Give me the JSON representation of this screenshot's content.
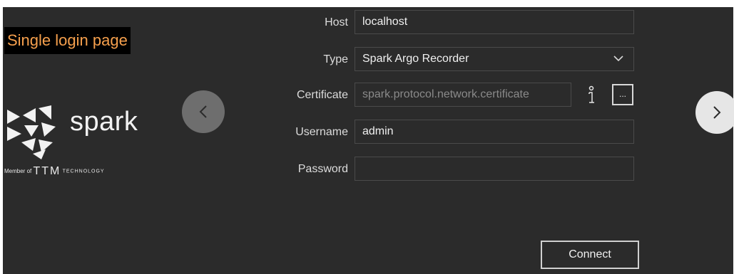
{
  "annotation": {
    "text": "Single login page"
  },
  "logo": {
    "word": "spark",
    "member_prefix": "Member of",
    "parent_brand": "TTM",
    "parent_suffix": "TECHNOLOGY"
  },
  "navigation": {
    "prev_icon": "chevron-left-icon",
    "next_icon": "chevron-right-icon"
  },
  "form": {
    "host": {
      "label": "Host",
      "value": "localhost"
    },
    "type": {
      "label": "Type",
      "value": "Spark Argo Recorder"
    },
    "certificate": {
      "label": "Certificate",
      "value": "spark.protocol.network.certificate",
      "browse_label": "..."
    },
    "username": {
      "label": "Username",
      "value": "admin"
    },
    "password": {
      "label": "Password",
      "value": ""
    }
  },
  "connect_button": {
    "label": "Connect"
  },
  "colors": {
    "background": "#2b2b2b",
    "annotation_text": "#f6a04d",
    "annotation_background": "#000000"
  }
}
